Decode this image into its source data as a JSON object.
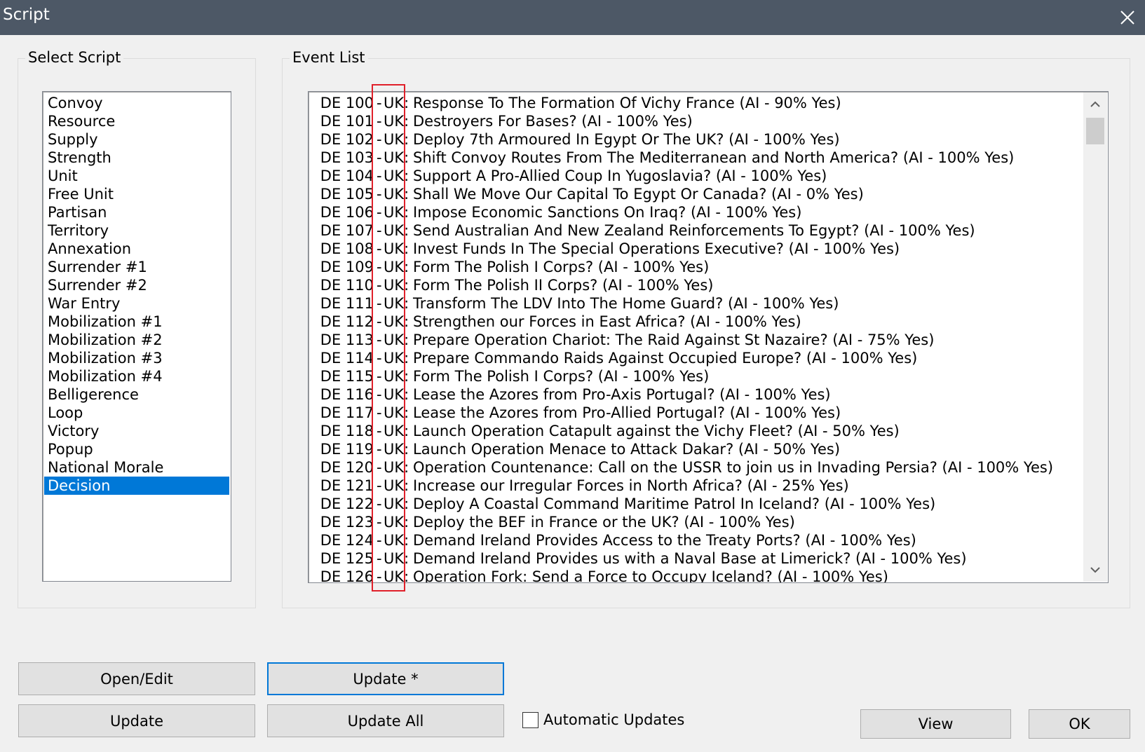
{
  "window": {
    "title": "Script"
  },
  "select_script": {
    "label": "Select Script",
    "items": [
      "Convoy",
      "Resource",
      "Supply",
      "Strength",
      "Unit",
      "Free Unit",
      "Partisan",
      "Territory",
      "Annexation",
      "Surrender #1",
      "Surrender #2",
      "War Entry",
      "Mobilization #1",
      "Mobilization #2",
      "Mobilization #3",
      "Mobilization #4",
      "Belligerence",
      "Loop",
      "Victory",
      "Popup",
      "National Morale",
      "Decision"
    ],
    "selected": "Decision"
  },
  "event_list": {
    "label": "Event List",
    "rows": [
      {
        "id": "DE 100",
        "country": "UK:",
        "text": "Response To The Formation Of Vichy France (AI - 90% Yes)"
      },
      {
        "id": "DE 101",
        "country": "UK:",
        "text": "Destroyers For Bases? (AI - 100% Yes)"
      },
      {
        "id": "DE 102",
        "country": "UK:",
        "text": "Deploy 7th Armoured In Egypt Or The UK? (AI - 100% Yes)"
      },
      {
        "id": "DE 103",
        "country": "UK:",
        "text": "Shift Convoy Routes From The Mediterranean and North America? (AI - 100% Yes)"
      },
      {
        "id": "DE 104",
        "country": "UK:",
        "text": "Support A Pro-Allied Coup In Yugoslavia? (AI - 100% Yes)"
      },
      {
        "id": "DE 105",
        "country": "UK:",
        "text": "Shall We Move Our Capital To Egypt Or Canada? (AI - 0% Yes)"
      },
      {
        "id": "DE 106",
        "country": "UK:",
        "text": "Impose Economic Sanctions On Iraq? (AI - 100% Yes)"
      },
      {
        "id": "DE 107",
        "country": "UK:",
        "text": "Send Australian And New Zealand Reinforcements To Egypt? (AI - 100% Yes)"
      },
      {
        "id": "DE 108",
        "country": "UK:",
        "text": "Invest Funds In The Special Operations Executive? (AI - 100% Yes)"
      },
      {
        "id": "DE 109",
        "country": "UK:",
        "text": "Form The Polish I Corps? (AI - 100% Yes)"
      },
      {
        "id": "DE 110",
        "country": "UK:",
        "text": "Form The Polish II Corps? (AI - 100% Yes)"
      },
      {
        "id": "DE 111",
        "country": "UK:",
        "text": "Transform The LDV Into The Home Guard? (AI - 100% Yes)"
      },
      {
        "id": "DE 112",
        "country": "UK:",
        "text": "Strengthen our Forces in East Africa? (AI - 100% Yes)"
      },
      {
        "id": "DE 113",
        "country": "UK:",
        "text": "Prepare Operation Chariot: The Raid Against St Nazaire? (AI - 75% Yes)"
      },
      {
        "id": "DE 114",
        "country": "UK:",
        "text": "Prepare Commando Raids Against Occupied Europe? (AI - 100% Yes)"
      },
      {
        "id": "DE 115",
        "country": "UK:",
        "text": "Form The Polish I Corps? (AI - 100% Yes)"
      },
      {
        "id": "DE 116",
        "country": "UK:",
        "text": "Lease the Azores from Pro-Axis Portugal? (AI - 100% Yes)"
      },
      {
        "id": "DE 117",
        "country": "UK:",
        "text": "Lease the Azores from Pro-Allied Portugal? (AI - 100% Yes)"
      },
      {
        "id": "DE 118",
        "country": "UK:",
        "text": "Launch Operation Catapult against the Vichy Fleet? (AI - 50% Yes)"
      },
      {
        "id": "DE 119",
        "country": "UK:",
        "text": "Launch Operation Menace to Attack Dakar? (AI - 50% Yes)"
      },
      {
        "id": "DE 120",
        "country": "UK:",
        "text": "Operation Countenance: Call on the USSR to join us in Invading Persia? (AI - 100% Yes)"
      },
      {
        "id": "DE 121",
        "country": "UK:",
        "text": "Increase our Irregular Forces in North Africa? (AI - 25% Yes)"
      },
      {
        "id": "DE 122",
        "country": "UK:",
        "text": "Deploy A Coastal Command Maritime Patrol In Iceland? (AI - 100% Yes)"
      },
      {
        "id": "DE 123",
        "country": "UK:",
        "text": "Deploy the BEF in France or the UK? (AI - 100% Yes)"
      },
      {
        "id": "DE 124",
        "country": "UK:",
        "text": "Demand Ireland Provides Access to the Treaty Ports? (AI - 100% Yes)"
      },
      {
        "id": "DE 125",
        "country": "UK:",
        "text": "Demand Ireland Provides us with a Naval Base at Limerick? (AI - 100% Yes)"
      },
      {
        "id": "DE 126",
        "country": "UK:",
        "text": "Operation Fork: Send a Force to Occupy Iceland? (AI - 100% Yes)"
      }
    ]
  },
  "buttons": {
    "open_edit": "Open/Edit",
    "update_star": "Update *",
    "update": "Update",
    "update_all": "Update All",
    "view": "View",
    "ok": "OK"
  },
  "automatic_updates": {
    "label": "Automatic Updates",
    "checked": false
  },
  "icons": {
    "close": "close-icon",
    "scroll_up": "chevron-up-icon",
    "scroll_down": "chevron-down-icon"
  },
  "colors": {
    "titlebar": "#4d5866",
    "selection": "#0078d7",
    "highlight": "#e0202a"
  }
}
